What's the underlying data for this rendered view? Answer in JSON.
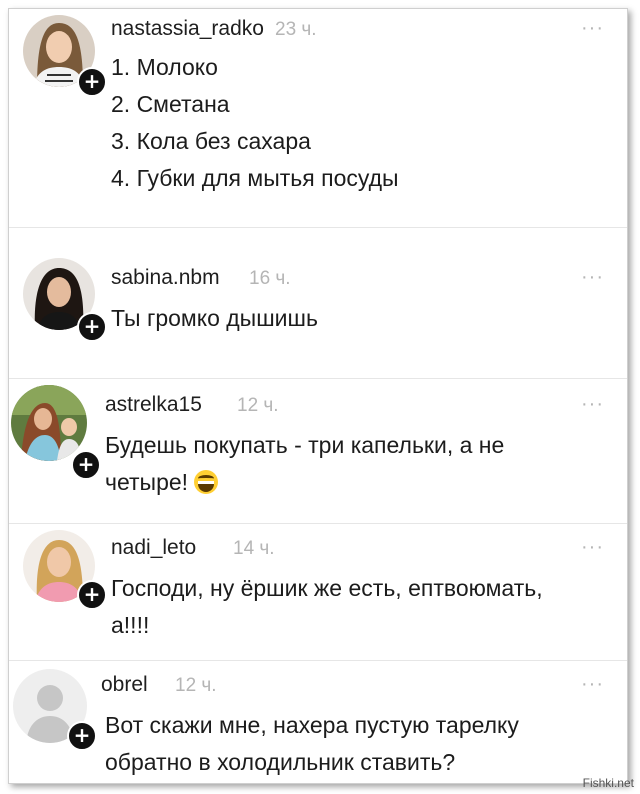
{
  "comments": [
    {
      "username": "nastassia_radko",
      "time": "23 ч.",
      "more": "···",
      "lines": [
        "1. Молоко",
        "2. Сметана",
        "3. Кола без сахара",
        "4. Губки для мытья посуды"
      ]
    },
    {
      "username": "sabina.nbm",
      "time": "16 ч.",
      "more": "···",
      "lines": [
        "Ты громко дышишь"
      ]
    },
    {
      "username": "astrelka15",
      "time": "12 ч.",
      "more": "···",
      "lines": [
        "Будешь покупать - три капельки, а не",
        "четыре!"
      ],
      "emoji": "grinning-emoji"
    },
    {
      "username": "nadi_leto",
      "time": "14 ч.",
      "more": "···",
      "lines": [
        "Господи, ну ёршик же есть, ептвоюмать,",
        "а!!!!"
      ]
    },
    {
      "username": "obrel",
      "time": "12 ч.",
      "more": "···",
      "lines": [
        "Вот скажи мне, нахера пустую тарелку",
        "обратно в холодильник ставить?"
      ]
    }
  ],
  "follow_label": "+",
  "watermark": "Fishki.net"
}
